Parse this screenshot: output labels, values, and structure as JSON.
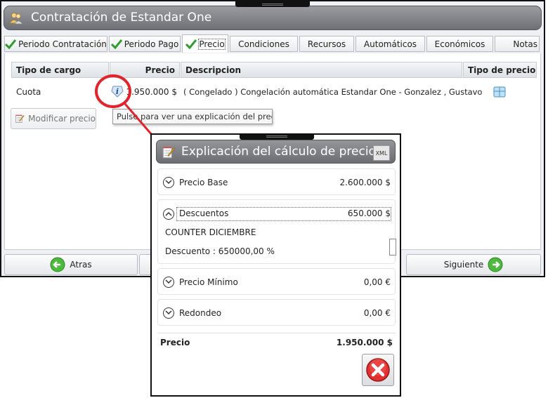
{
  "window": {
    "title": "Contratación de Estandar One"
  },
  "tabs": [
    {
      "label": "Periodo Contratación",
      "checked": true
    },
    {
      "label": "Periodo Pago",
      "checked": true
    },
    {
      "label": "Precio",
      "checked": true,
      "active": true
    },
    {
      "label": "Condiciones",
      "checked": false
    },
    {
      "label": "Recursos",
      "checked": false
    },
    {
      "label": "Automáticos",
      "checked": false
    },
    {
      "label": "Económicos",
      "checked": false
    },
    {
      "label": "Notas",
      "checked": false
    }
  ],
  "grid": {
    "headers": {
      "tipo_cargo": "Tipo de cargo",
      "precio": "Precio",
      "descripcion": "Descripcion",
      "tipo_precio": "Tipo de precio"
    },
    "row": {
      "tipo_cargo": "Cuota",
      "precio": "1.950.000 $",
      "descripcion": "( Congelado ) Congelación automática Estandar One - Gonzalez , Gustavo"
    }
  },
  "buttons": {
    "modificar_precio": "Modificar precio",
    "atras": "Atras",
    "siguiente": "Siguiente"
  },
  "tooltip": "Pulse para ver una explicación del precio.",
  "popup": {
    "title": "Explicación del cálculo de precios",
    "xml_badge": "XML",
    "sections": {
      "base": {
        "label": "Precio Base",
        "value": "2.600.000 $"
      },
      "descuentos": {
        "label": "Descuentos",
        "value": "650.000 $",
        "detail_name": "COUNTER DICIEMBRE",
        "detail_value": "Descuento : 650000,00 %"
      },
      "minimo": {
        "label": "Precio Mínimo",
        "value": "0,00 €"
      },
      "redondeo": {
        "label": "Redondeo",
        "value": "0,00 €"
      }
    },
    "total": {
      "label": "Precio",
      "value": "1.950.000 $"
    }
  },
  "colors": {
    "check_green": "#2e9d2e",
    "annotation_red": "#e2232b",
    "title_gray": "#7d7f84"
  }
}
